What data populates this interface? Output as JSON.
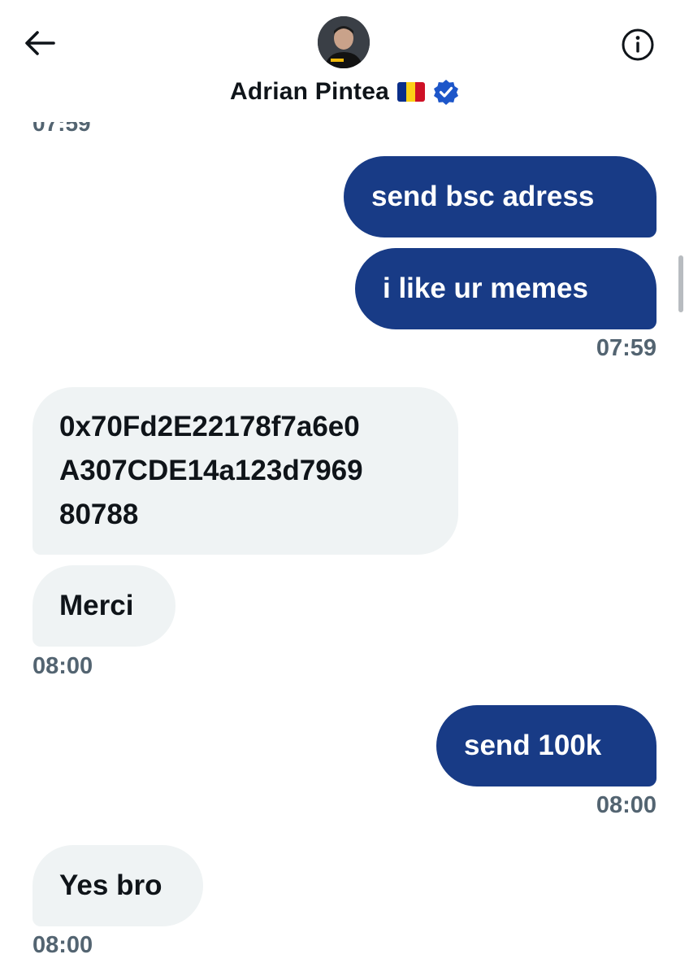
{
  "header": {
    "name": "Adrian Pintea",
    "avatar_alt": "Adrian Pintea",
    "flag_icon": "romania-flag-icon",
    "verified_icon": "verified-badge-icon",
    "back_icon": "back-arrow-icon",
    "info_icon": "info-icon",
    "verified_color": "#1d56c9"
  },
  "partial_timestamp": "07:59",
  "messages": [
    {
      "direction": "sent",
      "text": "send bsc adress"
    },
    {
      "direction": "sent",
      "text": "i  like ur memes",
      "time": "07:59"
    },
    {
      "direction": "received",
      "lines": [
        "0x70Fd2E22178f7a6e0",
        "A307CDE14a123d7969",
        "80788"
      ]
    },
    {
      "direction": "received",
      "text": "Merci",
      "time": "08:00"
    },
    {
      "direction": "sent",
      "text": "send 100k",
      "time": "08:00"
    },
    {
      "direction": "received",
      "text": "Yes bro",
      "time": "08:00"
    }
  ],
  "colors": {
    "sent_bubble": "#183b86",
    "received_bubble": "#eff3f4",
    "timestamp": "#536471"
  }
}
